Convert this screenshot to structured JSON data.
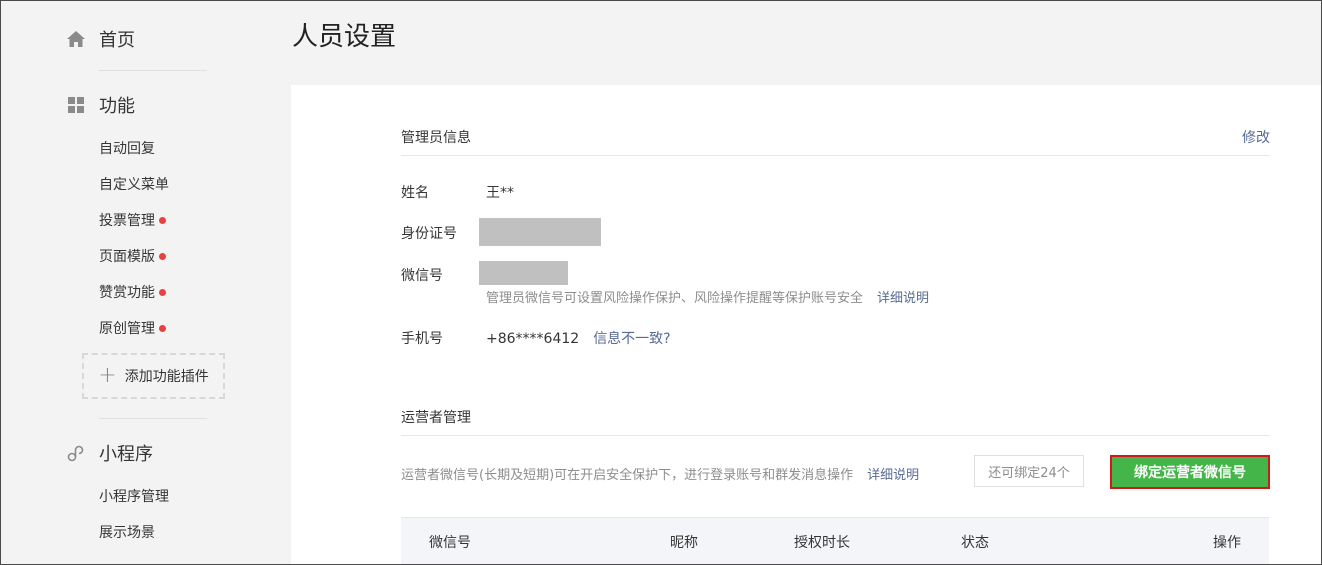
{
  "sidebar": {
    "home": {
      "label": "首页",
      "icon": "home-icon"
    },
    "features": {
      "label": "功能",
      "icon": "grid-icon"
    },
    "feature_items": [
      {
        "label": "自动回复",
        "new": false
      },
      {
        "label": "自定义菜单",
        "new": false
      },
      {
        "label": "投票管理",
        "new": true
      },
      {
        "label": "页面模版",
        "new": true
      },
      {
        "label": "赞赏功能",
        "new": true
      },
      {
        "label": "原创管理",
        "new": true
      }
    ],
    "add_plugin_label": "添加功能插件",
    "miniprogram": {
      "label": "小程序",
      "icon": "link-icon"
    },
    "miniprogram_items": [
      {
        "label": "小程序管理"
      },
      {
        "label": "展示场景"
      }
    ]
  },
  "page": {
    "title": "人员设置"
  },
  "admin_info": {
    "section_title": "管理员信息",
    "edit_label": "修改",
    "name_label": "姓名",
    "name_value": "王**",
    "id_label": "身份证号",
    "wechat_label": "微信号",
    "wechat_hint": "管理员微信号可设置风险操作保护、风险操作提醒等保护账号安全",
    "wechat_hint_link": "详细说明",
    "phone_label": "手机号",
    "phone_value": "+86****6412",
    "phone_link": "信息不一致?"
  },
  "operators": {
    "section_title": "运营者管理",
    "hint": "运营者微信号(长期及短期)可在开启安全保护下，进行登录账号和群发消息操作",
    "hint_link": "详细说明",
    "bind_count": "还可绑定24个",
    "bind_button": "绑定运营者微信号",
    "table_headers": [
      "微信号",
      "昵称",
      "授权时长",
      "状态",
      "操作"
    ]
  },
  "colors": {
    "accent_green": "#44b549",
    "link_blue": "#576b95",
    "new_dot_red": "#e64340",
    "highlight_border": "#d11919"
  }
}
